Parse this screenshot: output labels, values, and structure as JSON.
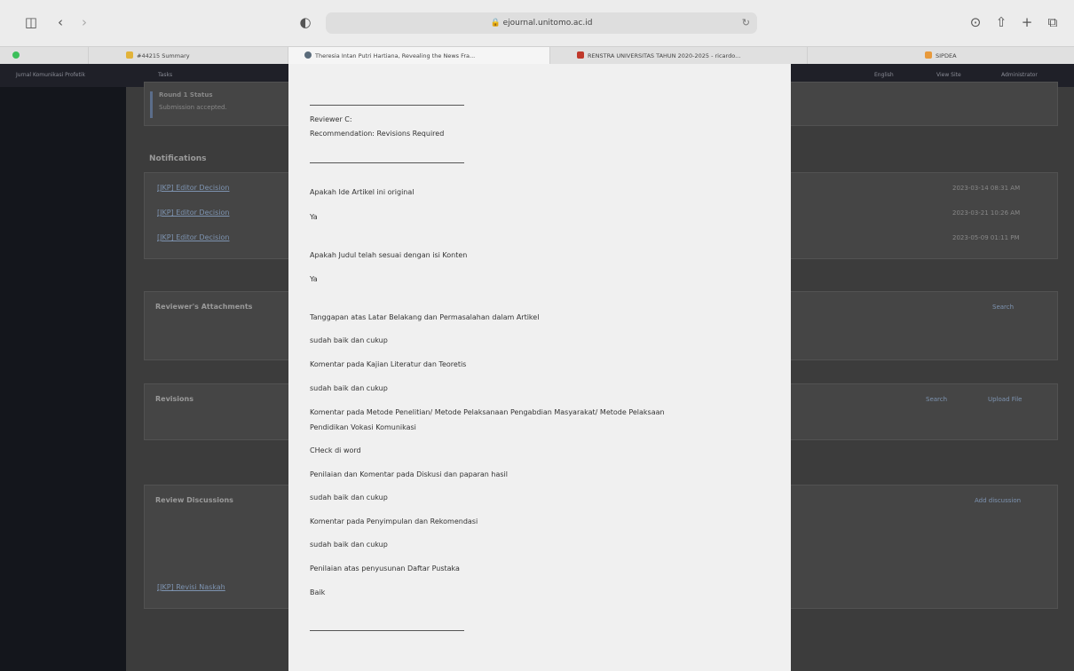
{
  "browser": {
    "address": "ejournal.unitomo.ac.id",
    "tabs": [
      {
        "title": "#44215 Summary",
        "color": "#e2b33a"
      },
      {
        "title": "Theresia Intan Putri Hartiana, Revealing the News Fra...",
        "color": "#5a6b7a"
      },
      {
        "title": "RENSTRA UNIVERSITAS TAHUN 2020-2025 - ricardo...",
        "color": "#c0392b"
      },
      {
        "title": "SIPDEA",
        "color": "#e89a3c"
      }
    ]
  },
  "background": {
    "appbar_left": "Jurnal Komunikasi Profetik",
    "appbar_tasks": "Tasks",
    "appbar_right": [
      "English",
      "View Site",
      "Administrator"
    ],
    "round_title": "Round 1 Status",
    "round_status": "Submission accepted.",
    "notifications_heading": "Notifications",
    "notifications": [
      {
        "label": "[JKP] Editor Decision",
        "date": "2023-03-14 08:31 AM"
      },
      {
        "label": "[JKP] Editor Decision",
        "date": "2023-03-21 10:26 AM"
      },
      {
        "label": "[JKP] Editor Decision",
        "date": "2023-05-09 01:11 PM"
      }
    ],
    "attachments_heading": "Reviewer's Attachments",
    "attachments_search": "Search",
    "revisions_heading": "Revisions",
    "revisions_search": "Search",
    "revisions_upload": "Upload File",
    "discussions_heading": "Review Discussions",
    "discussions_add": "Add discussion",
    "discussions_link": "[JKP] Revisi Naskah"
  },
  "review": {
    "reviewer_label": "Reviewer C:",
    "recommendation": "Recommendation: Revisions Required",
    "items": [
      {
        "q": "Apakah Ide Artikel ini original",
        "a": "Ya"
      },
      {
        "q": "Apakah Judul telah sesuai dengan isi Konten",
        "a": "Ya"
      },
      {
        "q": "Tanggapan atas Latar Belakang dan Permasalahan dalam Artikel",
        "a": "sudah baik dan cukup"
      },
      {
        "q": "Komentar pada Kajian Literatur dan Teoretis",
        "a": "sudah baik dan cukup"
      },
      {
        "q": "Komentar pada Metode Penelitian/ Metode Pelaksanaan Pengabdian Masyarakat/ Metode Pelaksaan",
        "q2": "Pendidikan Vokasi Komunikasi",
        "a": "CHeck di word"
      },
      {
        "q": "Penilaian dan Komentar pada Diskusi dan paparan hasil",
        "a": "sudah baik dan cukup"
      },
      {
        "q": "Komentar pada Penyimpulan dan Rekomendasi",
        "a": "sudah baik dan cukup"
      },
      {
        "q": "Penilaian atas penyusunan Daftar Pustaka",
        "a": "Baik"
      }
    ]
  }
}
